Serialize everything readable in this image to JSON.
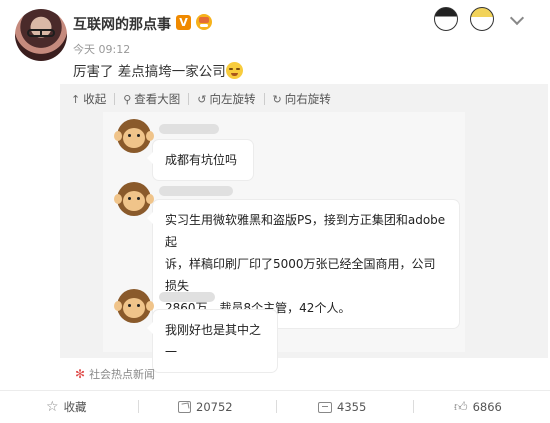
{
  "header": {
    "username": "互联网的那点事",
    "vip_badge": "V",
    "post_time": "今天 09:12",
    "post_text": "厉害了 差点搞垮一家公司"
  },
  "image_toolbar": {
    "collapse": "收起",
    "view_large": "查看大图",
    "rotate_left": "向左旋转",
    "rotate_right": "向右旋转"
  },
  "chat": {
    "messages": [
      {
        "text": "成都有坑位吗"
      },
      {
        "text_lines": [
          "实习生用微软雅黑和盗版PS，接到方正集团和adobe起",
          "诉，样稿印刷厂印了5000万张已经全国商用，公司损失",
          "2860万，裁员8个主管，42个人。"
        ]
      },
      {
        "text": "我刚好也是其中之一"
      }
    ]
  },
  "source_tag": "社会热点新闻",
  "actions": {
    "favorite": "收藏",
    "repost_count": "20752",
    "comment_count": "4355",
    "like_count": "6866"
  },
  "colors": {
    "vip_badge": "#f08a00",
    "source_asterisk": "#e0514f",
    "image_background": "#f2f2f2"
  }
}
